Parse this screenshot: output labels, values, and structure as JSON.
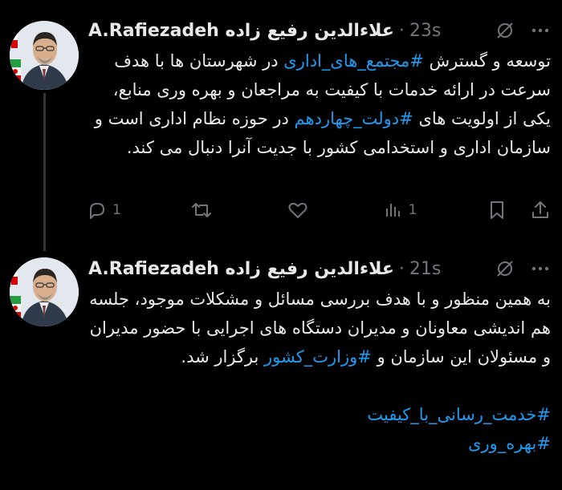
{
  "tweets": [
    {
      "author_display": "A.Rafiezadeh علاءالدین رفیع زاده",
      "separator": "·",
      "time": "23s",
      "text_parts": [
        "توسعه و گسترش ",
        "#مجتمع_های_اداری",
        " در شهرستان ها با هدف سرعت در ارائه خدمات با کیفیت به مراجعان و بهره وری منابع، یکی از اولویت های ",
        "#دولت_چهاردهم",
        " در حوزه نظام اداری است و سازمان اداری و استخدامی کشور با جدیت آنرا دنبال می کند."
      ],
      "actions": {
        "reply_count": "1",
        "retweet_count": "",
        "like_count": "",
        "views_count": "1"
      }
    },
    {
      "author_display": "A.Rafiezadeh علاءالدین رفیع زاده",
      "separator": "·",
      "time": "21s",
      "text_parts": [
        "به همین منظور و با هدف بررسی مسائل و مشکلات موجود، جلسه هم اندیشی معاونان و مدیران دستگاه های اجرایی  با حضور مدیران و مسئولان این سازمان و ",
        "#وزارت_کشور",
        " برگزار شد."
      ],
      "hashtags_footer": [
        "#خدمت_رسانی_با_کیفیت",
        "#بهره_وری"
      ]
    }
  ],
  "icons": {
    "mute": "mute-icon",
    "more": "more-icon",
    "reply": "reply-icon",
    "retweet": "retweet-icon",
    "like": "heart-icon",
    "views": "views-icon",
    "bookmark": "bookmark-icon",
    "share": "share-icon"
  },
  "colors": {
    "background": "#000000",
    "text": "#e7e9ea",
    "muted": "#71767b",
    "hashtag": "#1d9bf0",
    "thread_line": "#333639"
  }
}
